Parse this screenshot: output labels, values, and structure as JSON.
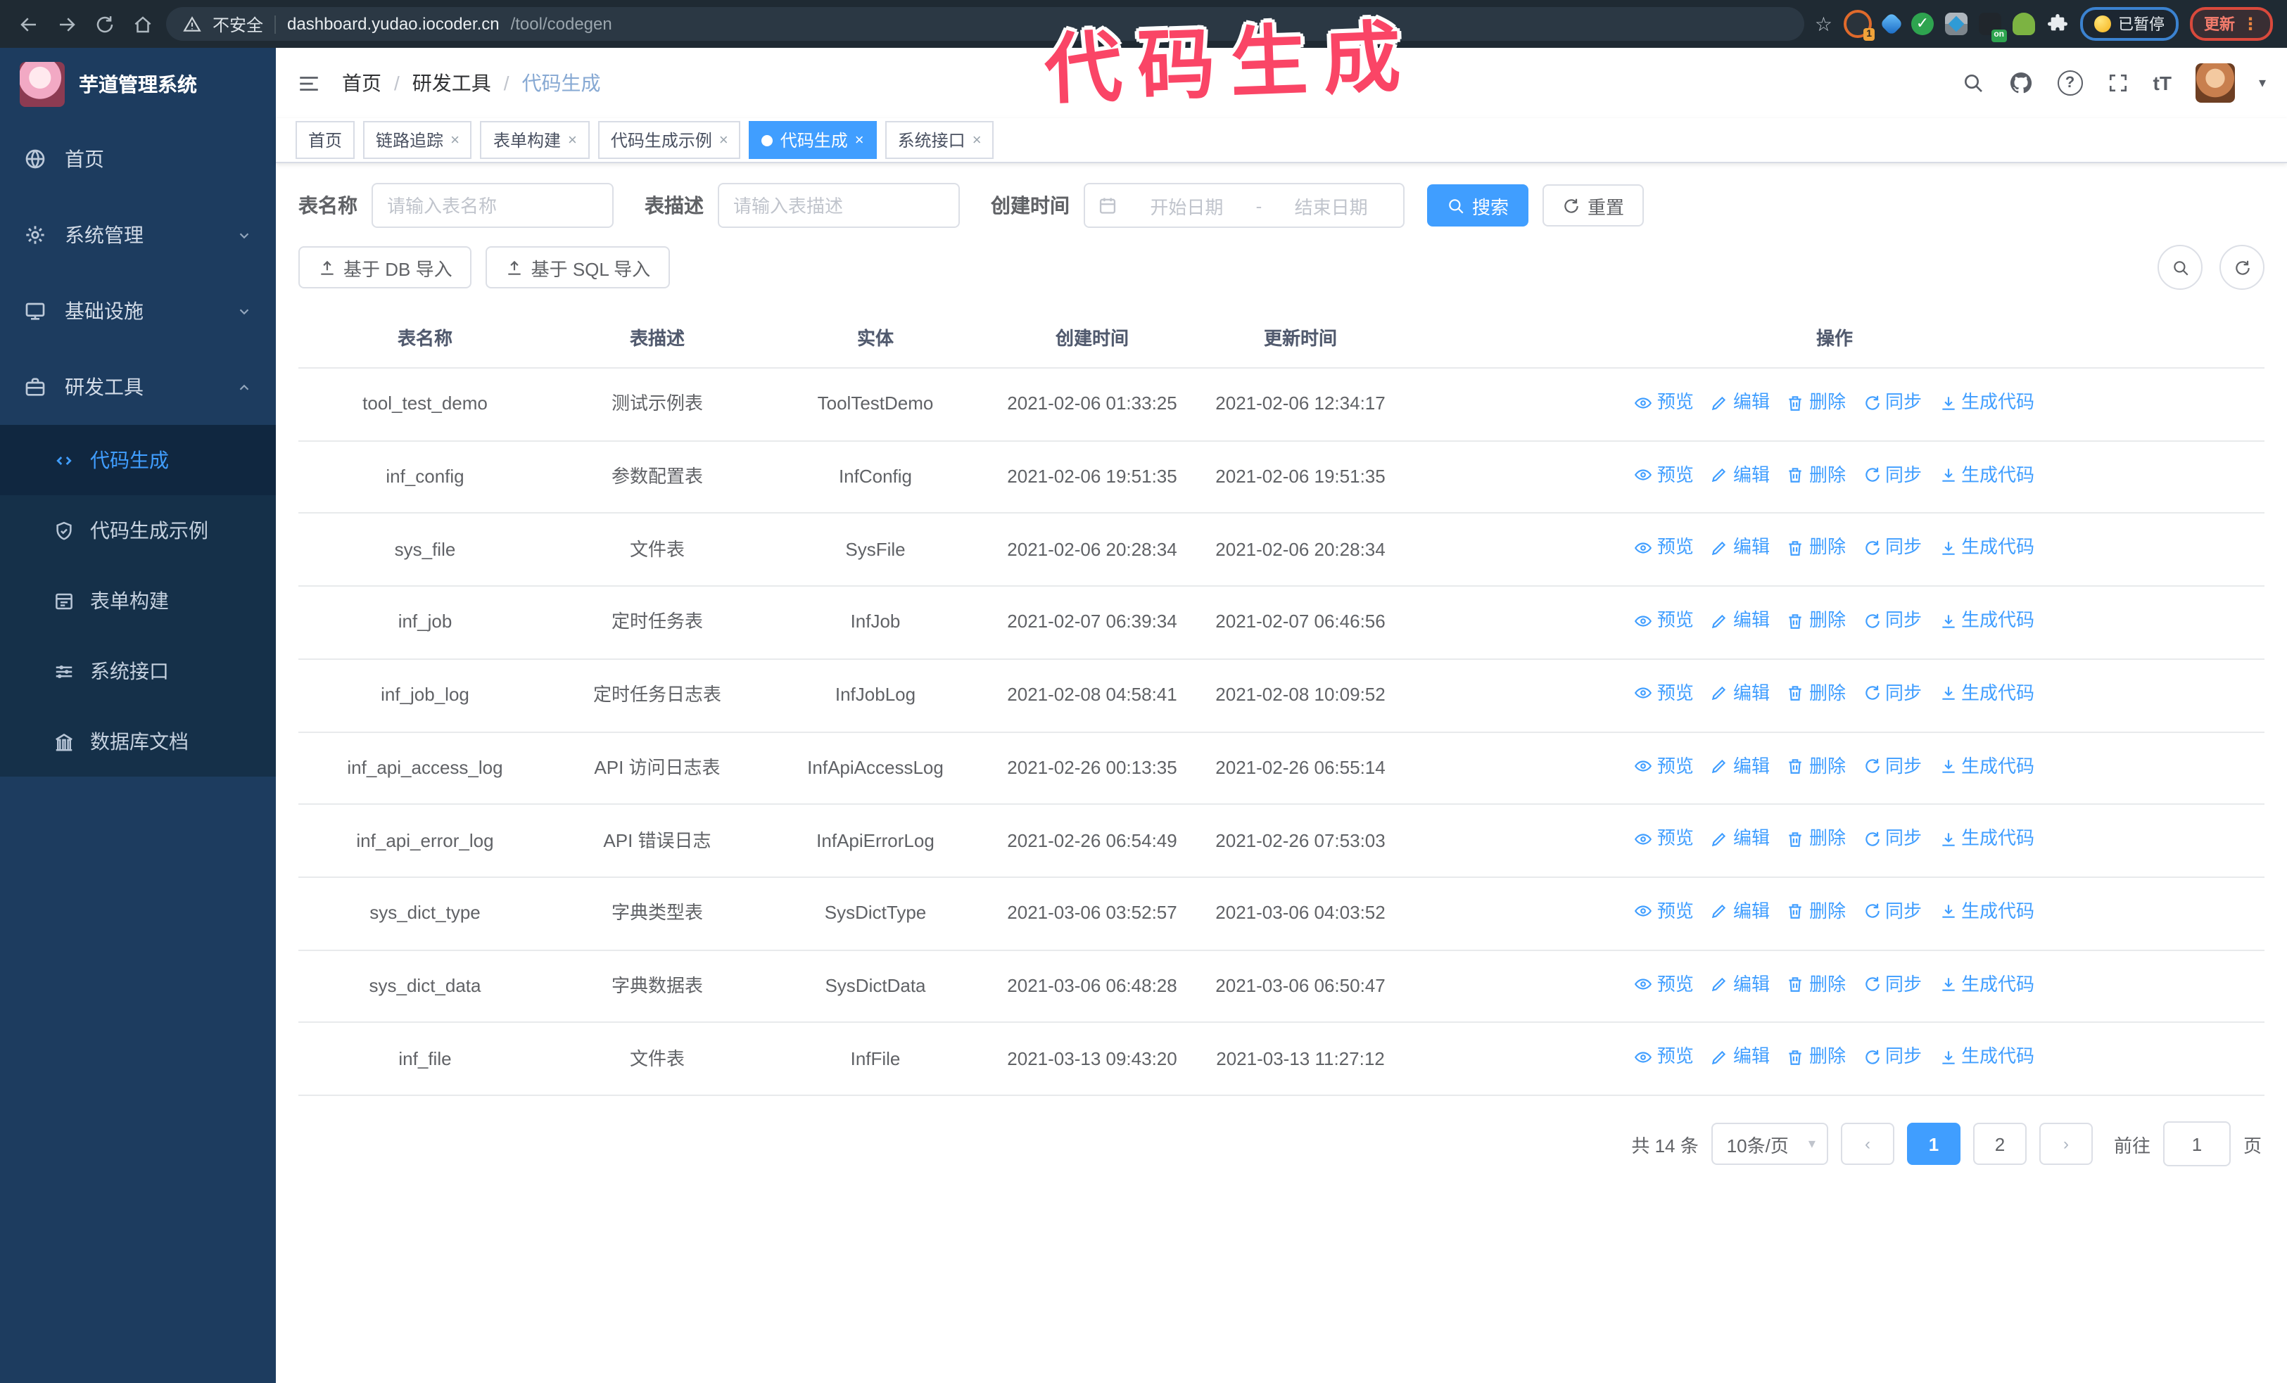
{
  "browser": {
    "security_label": "不安全",
    "url_host": "dashboard.yudao.iocoder.cn",
    "url_path": "/tool/codegen",
    "paused_badge": "已暂停",
    "update_button": "更新",
    "extension_badge": "1",
    "extension_on_badge": "on"
  },
  "annotation": {
    "title": "代码生成",
    "color": "#fa4566"
  },
  "icons": {
    "star": "☆",
    "caret_down": "▾",
    "overflow_dots": "⋮",
    "font_size": "tT",
    "help": "?",
    "close": "×",
    "range_separator": "-"
  },
  "sidebar": {
    "app_title": "芋道管理系统",
    "items": [
      {
        "label": "首页"
      },
      {
        "label": "系统管理"
      },
      {
        "label": "基础设施"
      },
      {
        "label": "研发工具"
      }
    ],
    "subitems": [
      {
        "label": "代码生成",
        "active": true
      },
      {
        "label": "代码生成示例"
      },
      {
        "label": "表单构建"
      },
      {
        "label": "系统接口"
      },
      {
        "label": "数据库文档"
      }
    ]
  },
  "header": {
    "breadcrumb": [
      "首页",
      "研发工具",
      "代码生成"
    ],
    "separator": "/"
  },
  "tabs": [
    {
      "label": "首页"
    },
    {
      "label": "链路追踪"
    },
    {
      "label": "表单构建"
    },
    {
      "label": "代码生成示例"
    },
    {
      "label": "代码生成"
    },
    {
      "label": "系统接口"
    }
  ],
  "filters": {
    "table_name_label": "表名称",
    "table_name_placeholder": "请输入表名称",
    "table_desc_label": "表描述",
    "table_desc_placeholder": "请输入表描述",
    "create_time_label": "创建时间",
    "date_start_placeholder": "开始日期",
    "date_end_placeholder": "结束日期",
    "search_button": "搜索",
    "reset_button": "重置"
  },
  "toolbar": {
    "import_db_button": "基于 DB 导入",
    "import_sql_button": "基于 SQL 导入"
  },
  "table": {
    "columns": [
      "表名称",
      "表描述",
      "实体",
      "创建时间",
      "更新时间",
      "操作"
    ],
    "actions": [
      "预览",
      "编辑",
      "删除",
      "同步",
      "生成代码"
    ],
    "rows": [
      {
        "name": "tool_test_demo",
        "desc": "测试示例表",
        "entity": "ToolTestDemo",
        "created": "2021-02-06 01:33:25",
        "updated": "2021-02-06 12:34:17"
      },
      {
        "name": "inf_config",
        "desc": "参数配置表",
        "entity": "InfConfig",
        "created": "2021-02-06 19:51:35",
        "updated": "2021-02-06 19:51:35"
      },
      {
        "name": "sys_file",
        "desc": "文件表",
        "entity": "SysFile",
        "created": "2021-02-06 20:28:34",
        "updated": "2021-02-06 20:28:34"
      },
      {
        "name": "inf_job",
        "desc": "定时任务表",
        "entity": "InfJob",
        "created": "2021-02-07 06:39:34",
        "updated": "2021-02-07 06:46:56"
      },
      {
        "name": "inf_job_log",
        "desc": "定时任务日志表",
        "entity": "InfJobLog",
        "created": "2021-02-08 04:58:41",
        "updated": "2021-02-08 10:09:52"
      },
      {
        "name": "inf_api_access_log",
        "desc": "API 访问日志表",
        "entity": "InfApiAccessLog",
        "created": "2021-02-26 00:13:35",
        "updated": "2021-02-26 06:55:14"
      },
      {
        "name": "inf_api_error_log",
        "desc": "API 错误日志",
        "entity": "InfApiErrorLog",
        "created": "2021-02-26 06:54:49",
        "updated": "2021-02-26 07:53:03"
      },
      {
        "name": "sys_dict_type",
        "desc": "字典类型表",
        "entity": "SysDictType",
        "created": "2021-03-06 03:52:57",
        "updated": "2021-03-06 04:03:52"
      },
      {
        "name": "sys_dict_data",
        "desc": "字典数据表",
        "entity": "SysDictData",
        "created": "2021-03-06 06:48:28",
        "updated": "2021-03-06 06:50:47"
      },
      {
        "name": "inf_file",
        "desc": "文件表",
        "entity": "InfFile",
        "created": "2021-03-13 09:43:20",
        "updated": "2021-03-13 11:27:12"
      }
    ]
  },
  "pagination": {
    "total_text": "共 14 条",
    "page_size": "10条/页",
    "prev": "‹",
    "next": "›",
    "pages": [
      "1",
      "2"
    ],
    "active_page": "1",
    "goto_label": "前往",
    "goto_value": "1",
    "goto_suffix": "页"
  },
  "colors": {
    "accent": "#409eff",
    "sidebar_bg": "#1d3c5f",
    "submenu_bg": "#153049",
    "chrome_bg": "#1f2a33",
    "annotation_pink": "#fa4566",
    "update_red": "#d9493c",
    "paused_blue": "#3b82d0"
  }
}
